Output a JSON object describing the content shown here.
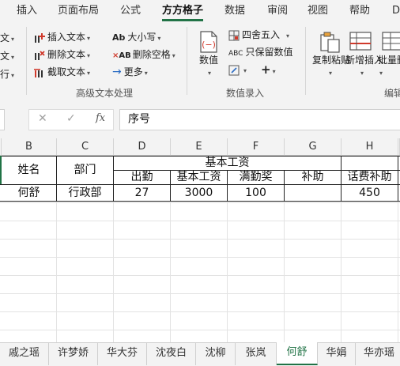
{
  "ribbon": {
    "tabs": [
      "插入",
      "页面布局",
      "公式",
      "方方格子",
      "数据",
      "审阅",
      "视图",
      "帮助",
      "D"
    ],
    "active_tab": "方方格子",
    "left_edge": [
      "文",
      "文",
      "行"
    ],
    "text_group": {
      "items": [
        "插入文本",
        "删除文本",
        "截取文本",
        "大小写",
        "删除空格",
        "更多"
      ],
      "label": "高级文本处理"
    },
    "value_group": {
      "numeric_label": "数值",
      "items": [
        "四舍五入",
        "只保留数值"
      ],
      "label": "数值录入"
    },
    "edit_group": {
      "copy_paste": "复制粘贴",
      "add_insert": "新增插入",
      "batch_delete": "批量删除",
      "label": "编辑"
    }
  },
  "formula_bar": {
    "fx": "fx",
    "content": "序号"
  },
  "columns": [
    "B",
    "C",
    "D",
    "E",
    "F",
    "G",
    "H"
  ],
  "table": {
    "header_name": "姓名",
    "header_dept": "部门",
    "header_group": "基本工资",
    "subheaders": [
      "出勤",
      "基本工资",
      "满勤奖",
      "补助",
      "话费补助"
    ],
    "row": [
      "何舒",
      "行政部",
      "27",
      "3000",
      "100",
      "",
      "450"
    ]
  },
  "sheets": [
    "戚之瑶",
    "许梦娇",
    "华大芬",
    "沈夜白",
    "沈柳",
    "张岚",
    "何舒",
    "华娟",
    "华亦瑶"
  ],
  "active_sheet": "何舒",
  "colors": {
    "accent": "#217346"
  }
}
